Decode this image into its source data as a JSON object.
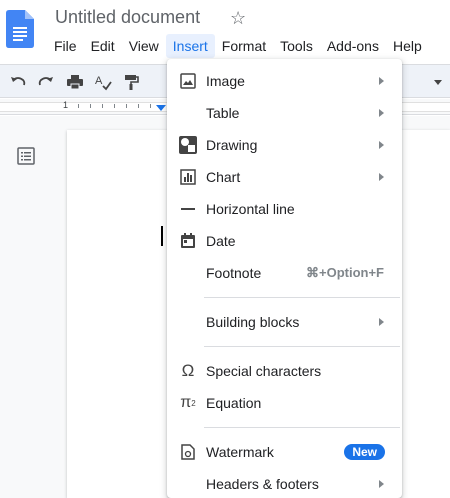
{
  "document": {
    "title": "Untitled document"
  },
  "menubar": {
    "items": [
      "File",
      "Edit",
      "View",
      "Insert",
      "Format",
      "Tools",
      "Add-ons",
      "Help"
    ],
    "active": "Insert"
  },
  "ruler": {
    "label": "1"
  },
  "insert_menu": {
    "image": "Image",
    "table": "Table",
    "drawing": "Drawing",
    "chart": "Chart",
    "horizontal_line": "Horizontal line",
    "date": "Date",
    "footnote": "Footnote",
    "footnote_shortcut": "⌘+Option+F",
    "building_blocks": "Building blocks",
    "special_characters": "Special characters",
    "equation": "Equation",
    "watermark": "Watermark",
    "watermark_badge": "New",
    "headers_footers": "Headers & footers"
  },
  "colors": {
    "accent": "#1a73e8",
    "active_menu_bg": "#e8f0fe",
    "toolbar_bg": "#eef2f8"
  },
  "icons": {
    "logo": "docs-logo-icon",
    "star": "star-icon",
    "undo": "undo-icon",
    "redo": "redo-icon",
    "print": "print-icon",
    "spellcheck": "spellcheck-icon",
    "paint_format": "paint-format-icon",
    "outline": "document-outline-icon"
  }
}
